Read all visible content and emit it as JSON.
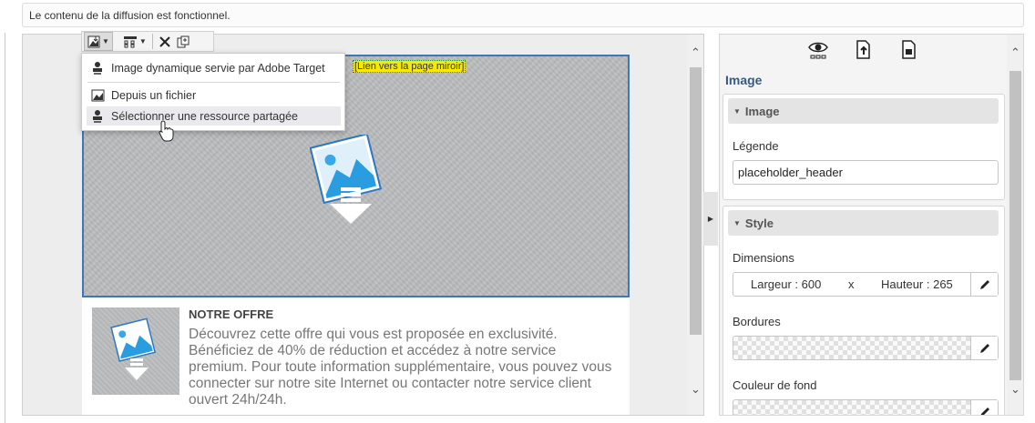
{
  "status": {
    "message": "Le contenu de la diffusion est fonctionnel."
  },
  "editor": {
    "mirror_link": "[Lien vers la page miroir]",
    "toolbar": {
      "image_button": "image-dropdown-button",
      "layout_button": "layout-dropdown-button",
      "delete_button": "delete-icon",
      "duplicate_button": "duplicate-icon"
    },
    "menu": {
      "items": [
        {
          "label": "Image dynamique servie par Adobe Target",
          "icon": "shared-resource-icon"
        },
        {
          "label": "Depuis un fichier",
          "icon": "image-file-icon"
        },
        {
          "label": "Sélectionner une ressource partagée",
          "icon": "shared-resource-icon"
        }
      ]
    },
    "offer": {
      "title": "NOTRE OFFRE",
      "body": "Découvrez cette offre qui vous est proposée en exclusivité. Bénéficiez de 40% de réduction et accédez à notre service premium. Pour toute information supplémentaire, vous pouvez vous connecter sur notre site Internet ou contacter notre service client ouvert 24h/24h."
    }
  },
  "panel": {
    "tabs": [
      "eye-icon",
      "import-document-icon",
      "document-settings-icon"
    ],
    "title": "Image",
    "image_section": {
      "header": "Image",
      "caption_label": "Légende",
      "caption_value": "placeholder_header"
    },
    "style_section": {
      "header": "Style",
      "dimensions_label": "Dimensions",
      "width_text": "Largeur : 600",
      "times": "x",
      "height_text": "Hauteur : 265",
      "borders_label": "Bordures",
      "background_label": "Couleur de fond"
    }
  },
  "colors": {
    "selection_border": "#3f77b5",
    "mirror_link_bg": "#f7ea00",
    "panel_title": "#3a5a7f"
  }
}
